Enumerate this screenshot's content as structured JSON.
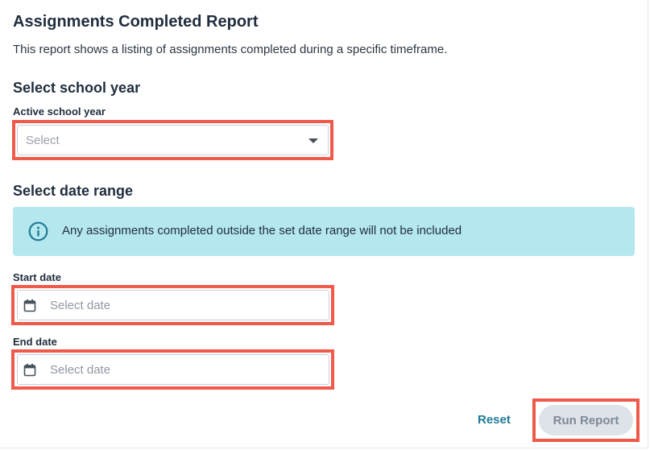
{
  "report": {
    "title": "Assignments Completed Report",
    "description": "This report shows a listing of assignments completed during a specific timeframe."
  },
  "school_year": {
    "section_title": "Select school year",
    "label": "Active school year",
    "placeholder": "Select",
    "icon": "chevron-down-icon"
  },
  "date_range": {
    "section_title": "Select date range",
    "info_icon": "info-icon",
    "info_text": "Any assignments completed outside the set date range will not be included",
    "start_label": "Start date",
    "start_placeholder": "Select date",
    "end_label": "End date",
    "end_placeholder": "Select date",
    "date_icon": "calendar-icon"
  },
  "actions": {
    "reset_label": "Reset",
    "run_label": "Run Report"
  },
  "colors": {
    "highlight": "#ef5a4b",
    "info_background": "#b5e7ef",
    "link": "#1f7a95",
    "disabled_button": "#dde3e9"
  }
}
